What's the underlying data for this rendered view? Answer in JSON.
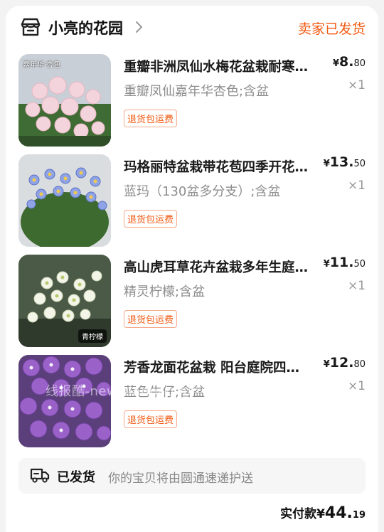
{
  "shop": {
    "name": "小亮的花园",
    "status": "卖家已发货",
    "icon": "shop-icon"
  },
  "items": [
    {
      "title": "重瓣非洲凤仙水梅花盆栽耐寒…",
      "spec": "重瓣凤仙嘉年华杏色;含盆",
      "price_yen": "¥",
      "price_int": "8.",
      "price_dec": "80",
      "qty": "×1",
      "tag": "退货包运费",
      "thumb_label": "嘉年华·杏色",
      "flower_color": "#f4d4dc"
    },
    {
      "title": "玛格丽特盆栽带花苞四季开花…",
      "spec": "蓝玛（130盆多分支）;含盆",
      "price_yen": "¥",
      "price_int": "13.",
      "price_dec": "50",
      "qty": "×1",
      "tag": "退货包运费",
      "thumb_label": "",
      "flower_color": "#8fa4e6"
    },
    {
      "title": "高山虎耳草花卉盆栽多年生庭…",
      "spec": "精灵柠檬;含盆",
      "price_yen": "¥",
      "price_int": "11.",
      "price_dec": "50",
      "qty": "×1",
      "tag": "退货包运费",
      "thumb_label": "青柠檬",
      "flower_color": "#f2f5e8"
    },
    {
      "title": "芳香龙面花盆栽 阳台庭院四…",
      "spec": "蓝色牛仔;含盆",
      "price_yen": "¥",
      "price_int": "12.",
      "price_dec": "80",
      "qty": "×1",
      "tag": "退货包运费",
      "thumb_label": "",
      "flower_color": "#9a62c9"
    }
  ],
  "shipping": {
    "status": "已发货",
    "description": "你的宝贝将由圆通速递护送",
    "icon": "truck-icon"
  },
  "total": {
    "label": "实付款",
    "yen": "¥",
    "int": "44.",
    "dec": "19"
  },
  "watermark": "线报酷-new.xianbao.fun",
  "colors": {
    "accent": "#f25a12",
    "tag_border": "#f6a98a",
    "muted": "#8d8d8d"
  }
}
